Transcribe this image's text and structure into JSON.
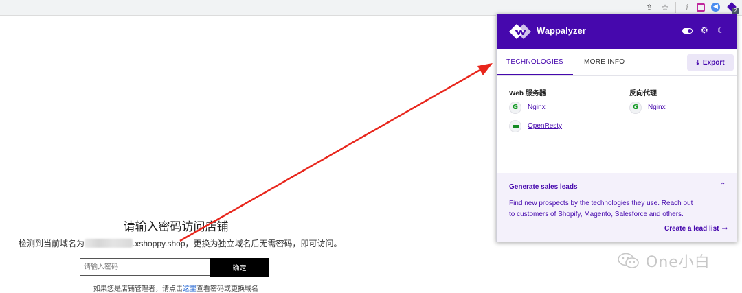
{
  "page": {
    "title": "请输入密码访问店铺",
    "domain_prefix": "检测到当前域名为",
    "domain_suffix": ".xshoppy.shop，更换为独立域名后无需密码，即可访问。",
    "password_placeholder": "请输入密码",
    "confirm_label": "确定",
    "admin_note_before": "如果您是店铺管理者，请点击",
    "admin_note_link": "这里",
    "admin_note_after": "查看密码或更换域名"
  },
  "wappalyzer": {
    "brand": "Wappalyzer",
    "brand_color": "#4608ad",
    "tabs": [
      {
        "label": "TECHNOLOGIES",
        "active": true
      },
      {
        "label": "MORE INFO",
        "active": false
      }
    ],
    "export_label": "Export",
    "categories": [
      {
        "name": "Web 服务器",
        "technologies": [
          {
            "name": "Nginx",
            "icon": "nginx-icon"
          },
          {
            "name": "OpenResty",
            "icon": "openresty-icon"
          }
        ]
      },
      {
        "name": "反向代理",
        "technologies": [
          {
            "name": "Nginx",
            "icon": "nginx-icon"
          }
        ]
      }
    ],
    "leads": {
      "title": "Generate sales leads",
      "line1": "Find new prospects by the technologies they use. Reach out",
      "line2": "to customers of Shopify, Magento, Salesforce and others.",
      "link": "Create a lead list"
    }
  },
  "toolbar": {
    "extension_badge": "2"
  },
  "watermark": {
    "text": "One小白"
  },
  "colors": {
    "arrow": "#e8261c",
    "button_bg": "#000000"
  }
}
